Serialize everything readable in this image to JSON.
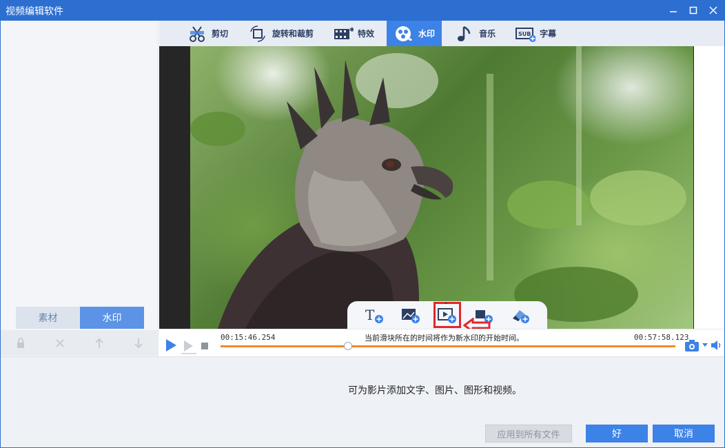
{
  "window": {
    "title": "视频编辑软件",
    "minimize_icon": "minimize-icon",
    "maximize_icon": "maximize-icon",
    "close_icon": "close-icon"
  },
  "toolbar": {
    "tabs": [
      {
        "label": "剪切",
        "icon": "scissors-icon",
        "active": false
      },
      {
        "label": "旋转和裁剪",
        "icon": "rotate-crop-icon",
        "active": false
      },
      {
        "label": "特效",
        "icon": "film-effects-icon",
        "active": false
      },
      {
        "label": "水印",
        "icon": "watermark-icon",
        "active": true
      },
      {
        "label": "音乐",
        "icon": "music-note-icon",
        "active": false
      },
      {
        "label": "字幕",
        "icon": "subtitle-icon",
        "active": false
      }
    ]
  },
  "left_panel": {
    "tabs": [
      {
        "label": "素材",
        "active": false
      },
      {
        "label": "水印",
        "active": true
      }
    ],
    "tools": [
      "lock-icon",
      "delete-x-icon",
      "arrow-up-icon",
      "arrow-down-icon"
    ]
  },
  "watermark_tools": [
    "add-text-icon",
    "add-image-icon",
    "add-video-icon",
    "add-shape-icon",
    "add-eraser-icon"
  ],
  "timeline": {
    "start_time": "00:15:46.254",
    "end_time": "00:57:58.123",
    "hint": "当前滑块所在的时间将作为新水印的开始时间。",
    "slider_position": 0.28
  },
  "bottom": {
    "message": "可为影片添加文字、图片、图形和视频。",
    "apply_all_label": "应用到所有文件",
    "ok_label": "好",
    "cancel_label": "取消"
  },
  "colors": {
    "accent": "#3d82e6",
    "titlebar": "#2d6fd1",
    "progress": "#f08a24",
    "highlight": "#e1262c"
  }
}
